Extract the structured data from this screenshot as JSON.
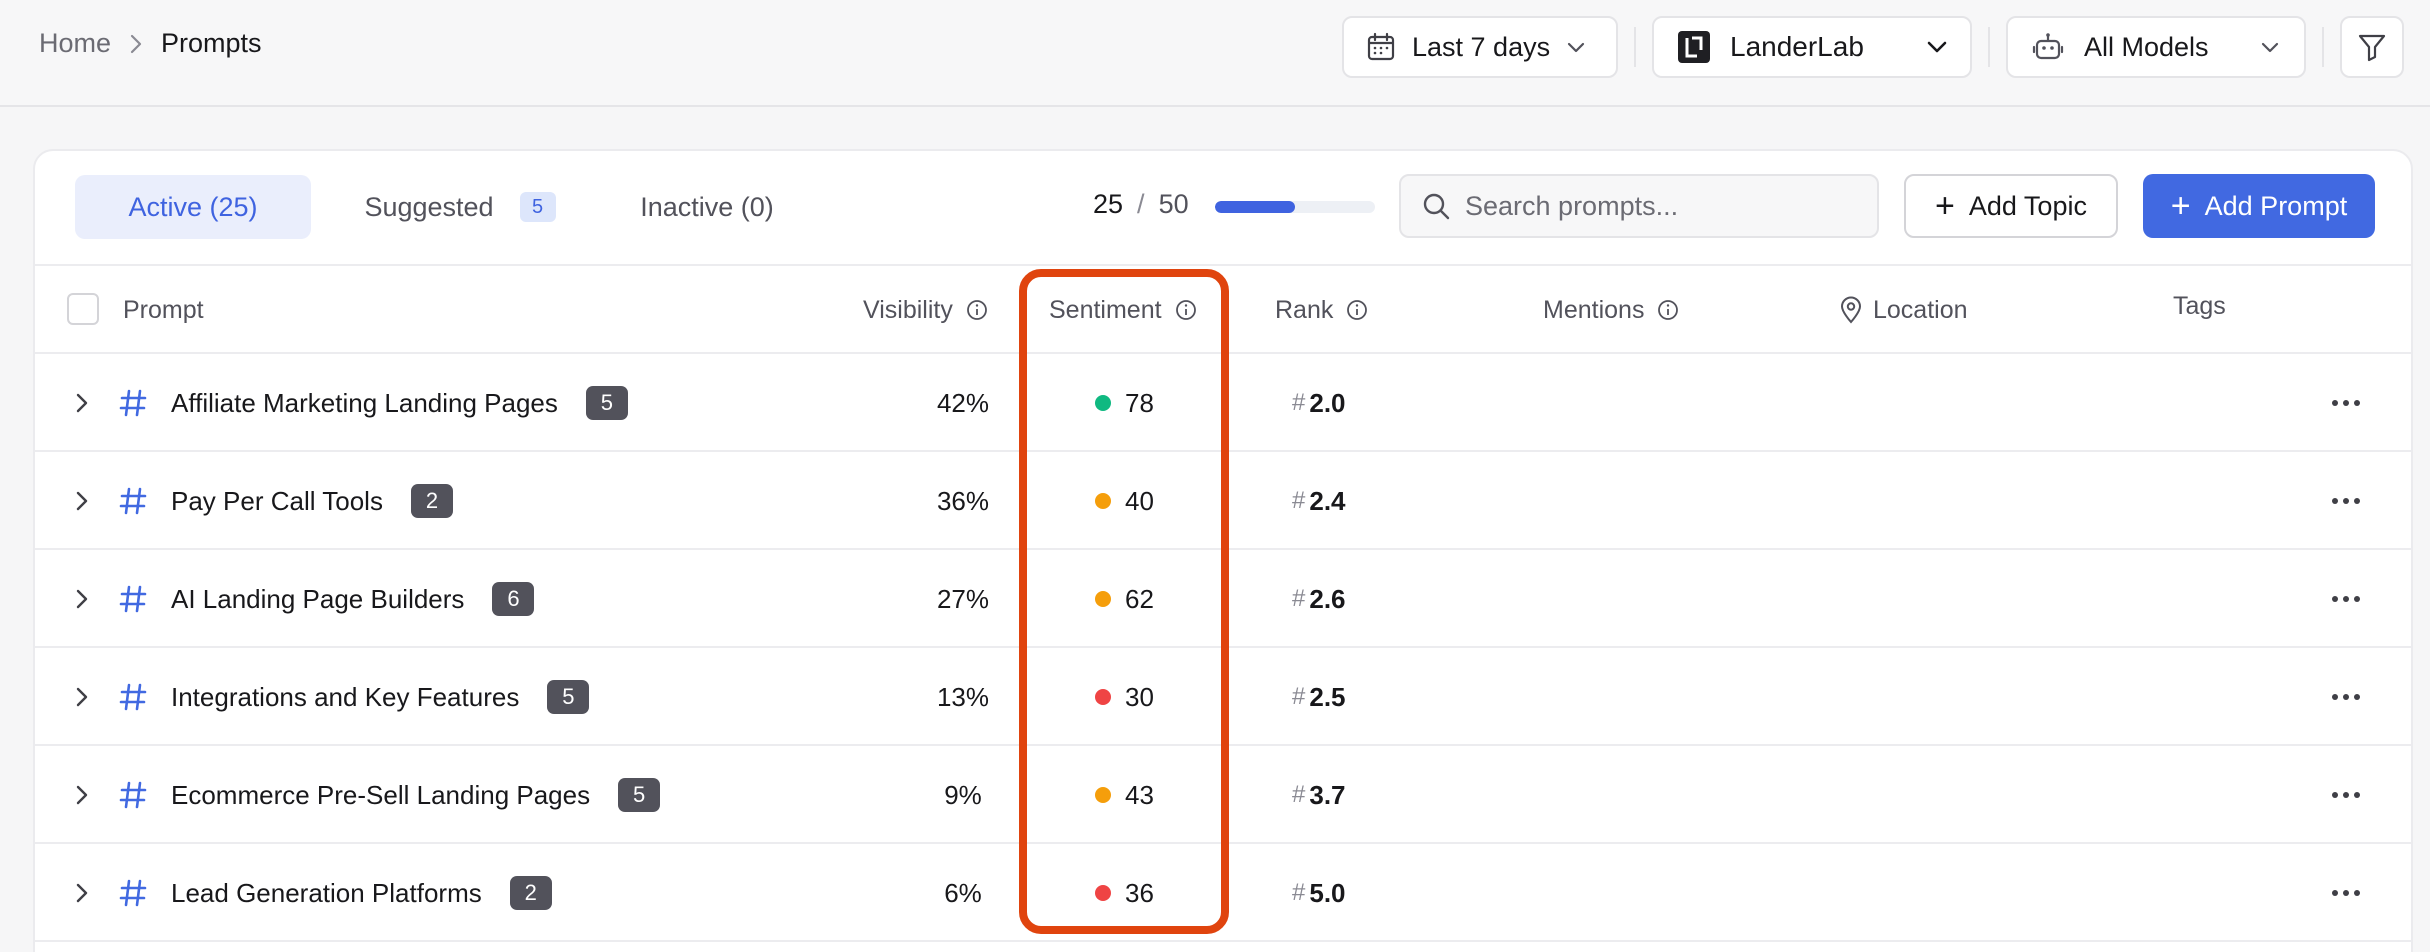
{
  "breadcrumb": {
    "home": "Home",
    "current": "Prompts"
  },
  "controls": {
    "date_range": "Last 7 days",
    "brand": "LanderLab",
    "models": "All Models"
  },
  "tabs": [
    {
      "label": "Active (25)",
      "active": true
    },
    {
      "label": "Suggested",
      "badge": "5"
    },
    {
      "label": "Inactive (0)"
    }
  ],
  "quota": {
    "used": "25",
    "slash": "/",
    "total": "50",
    "fraction": 0.5
  },
  "search": {
    "placeholder": "Search prompts..."
  },
  "buttons": {
    "add_topic": "Add Topic",
    "add_prompt": "Add Prompt",
    "plus": "+"
  },
  "columns": {
    "prompt": "Prompt",
    "visibility": "Visibility",
    "sentiment": "Sentiment",
    "rank": "Rank",
    "mentions": "Mentions",
    "location": "Location",
    "tags": "Tags"
  },
  "rows": [
    {
      "name": "Affiliate Marketing Landing Pages",
      "count": "5",
      "visibility": "42%",
      "sentiment": "78",
      "sentiment_color": "#10b981",
      "rank": "2.0"
    },
    {
      "name": "Pay Per Call Tools",
      "count": "2",
      "visibility": "36%",
      "sentiment": "40",
      "sentiment_color": "#f59e0b",
      "rank": "2.4"
    },
    {
      "name": "AI Landing Page Builders",
      "count": "6",
      "visibility": "27%",
      "sentiment": "62",
      "sentiment_color": "#f59e0b",
      "rank": "2.6"
    },
    {
      "name": "Integrations and Key Features",
      "count": "5",
      "visibility": "13%",
      "sentiment": "30",
      "sentiment_color": "#ef4444",
      "rank": "2.5"
    },
    {
      "name": "Ecommerce Pre-Sell Landing Pages",
      "count": "5",
      "visibility": "9%",
      "sentiment": "43",
      "sentiment_color": "#f59e0b",
      "rank": "3.7"
    },
    {
      "name": "Lead Generation Platforms",
      "count": "2",
      "visibility": "6%",
      "sentiment": "36",
      "sentiment_color": "#ef4444",
      "rank": "5.0"
    }
  ],
  "rank_prefix": "#",
  "hash_icon": "#",
  "colors": {
    "accent": "#4169e1",
    "highlight": "#e0440e"
  }
}
